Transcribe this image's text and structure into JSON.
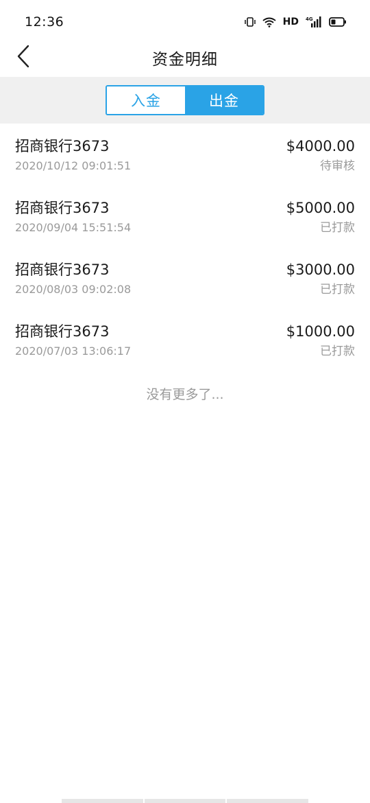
{
  "status_bar": {
    "time": "12:36",
    "network_label": "HD",
    "signal_label": "4G",
    "icons": [
      "vibrate-icon",
      "wifi-icon",
      "signal-icon",
      "battery-icon"
    ]
  },
  "header": {
    "title": "资金明细",
    "back_icon": "chevron-left-icon"
  },
  "tabs": [
    {
      "label": "入金",
      "active": false
    },
    {
      "label": "出金",
      "active": true
    }
  ],
  "transactions": [
    {
      "bank": "招商银行3673",
      "time": "2020/10/12 09:01:51",
      "amount": "$4000.00",
      "status": "待审核"
    },
    {
      "bank": "招商银行3673",
      "time": "2020/09/04 15:51:54",
      "amount": "$5000.00",
      "status": "已打款"
    },
    {
      "bank": "招商银行3673",
      "time": "2020/08/03 09:02:08",
      "amount": "$3000.00",
      "status": "已打款"
    },
    {
      "bank": "招商银行3673",
      "time": "2020/07/03 13:06:17",
      "amount": "$1000.00",
      "status": "已打款"
    }
  ],
  "footer": {
    "no_more": "没有更多了..."
  },
  "colors": {
    "accent": "#2aa3e6",
    "text_primary": "#1a1a1a",
    "text_secondary": "#9a9a9a",
    "tab_strip_bg": "#f0f0f0"
  }
}
